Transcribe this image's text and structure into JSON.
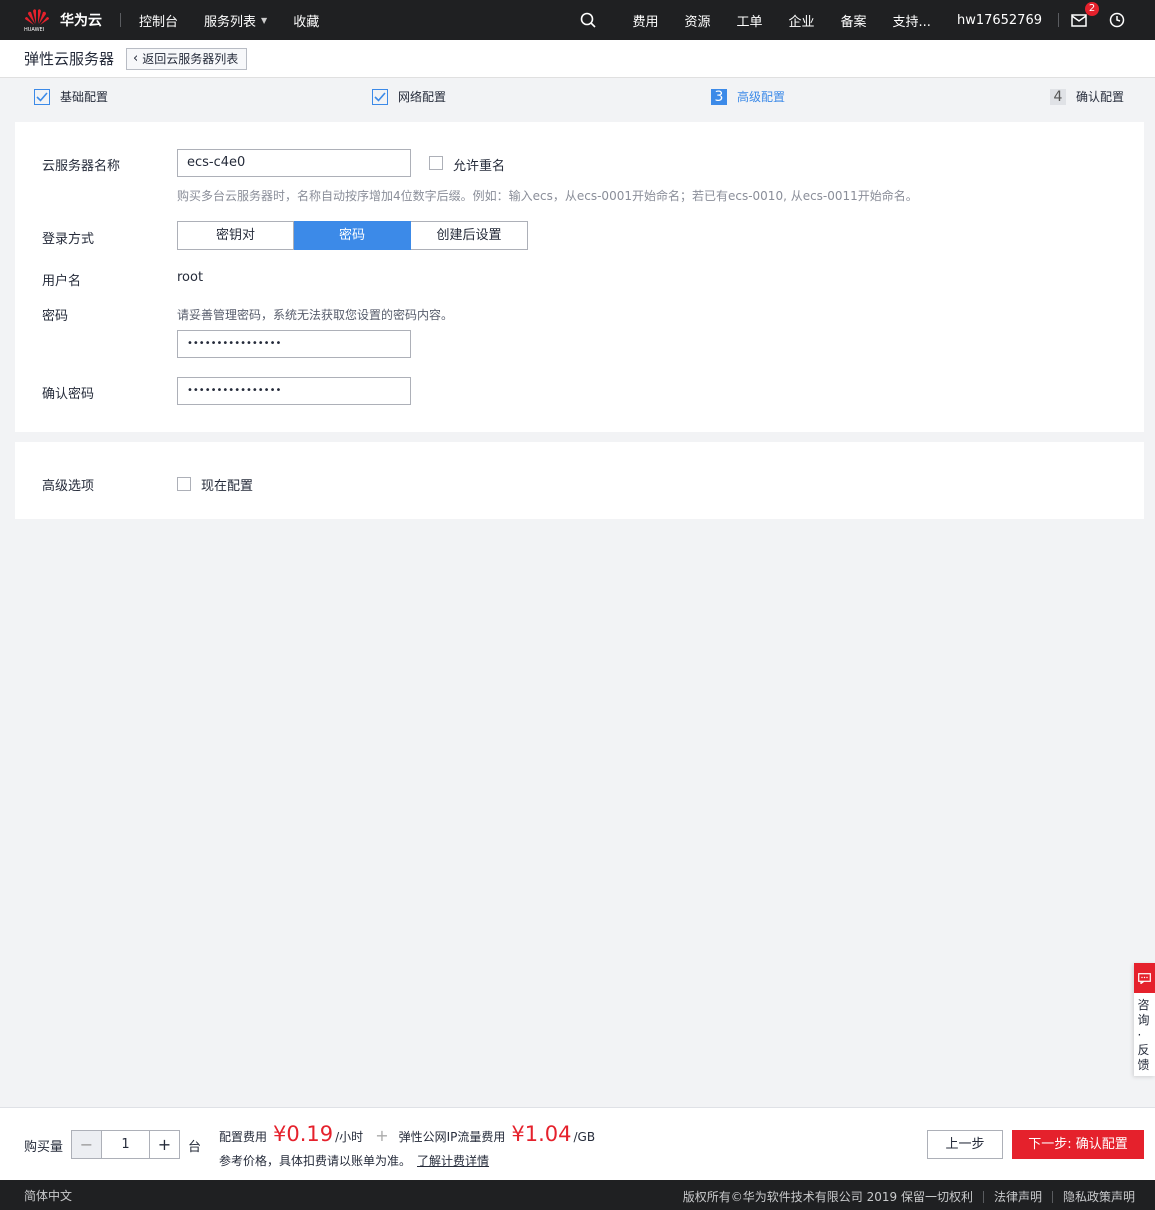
{
  "topbar": {
    "logo_text": "华为云",
    "logo_brand": "HUAWEI",
    "nav": [
      "控制台",
      "服务列表",
      "收藏"
    ],
    "right_items": [
      "费用",
      "资源",
      "工单",
      "企业",
      "备案",
      "支持..."
    ],
    "username": "hw17652769",
    "mail_badge": "2"
  },
  "subheader": {
    "title": "弹性云服务器",
    "back_label": "返回云服务器列表"
  },
  "steps": [
    {
      "label": "基础配置",
      "state": "done"
    },
    {
      "label": "网络配置",
      "state": "done"
    },
    {
      "label": "高级配置",
      "state": "active",
      "number": "3"
    },
    {
      "label": "确认配置",
      "state": "todo",
      "number": "4"
    }
  ],
  "form": {
    "name_label": "云服务器名称",
    "name_value": "ecs-c4e0",
    "allow_dup_label": "允许重名",
    "name_hint": "购买多台云服务器时，名称自动按序增加4位数字后缀。例如：输入ecs，从ecs-0001开始命名；若已有ecs-0010, 从ecs-0011开始命名。",
    "login_label": "登录方式",
    "login_options": [
      "密钥对",
      "密码",
      "创建后设置"
    ],
    "login_selected": "密码",
    "username_label": "用户名",
    "username_value": "root",
    "password_label": "密码",
    "password_hint": "请妥善管理密码，系统无法获取您设置的密码内容。",
    "password_value": "••••••••••••••••",
    "confirm_label": "确认密码",
    "confirm_value": "••••••••••••••••"
  },
  "advanced": {
    "label": "高级选项",
    "option_label": "现在配置"
  },
  "purchase": {
    "qty_label": "购买量",
    "qty_value": "1",
    "minus": "−",
    "plus": "+",
    "unit": "台",
    "config_fee_label": "配置费用",
    "config_fee_value": "¥0.19",
    "config_fee_unit": "/小时",
    "plus_sign": "+",
    "ip_fee_label": "弹性公网IP流量费用",
    "ip_fee_value": "¥1.04",
    "ip_fee_unit": "/GB",
    "ref_text": "参考价格，具体扣费请以账单为准。",
    "ref_link": "了解计费详情",
    "prev_label": "上一步",
    "next_label": "下一步: 确认配置"
  },
  "footer": {
    "lang": "简体中文",
    "copyright": "版权所有©华为软件技术有限公司 2019 保留一切权利",
    "legal": "法律声明",
    "privacy": "隐私政策声明"
  },
  "feedback": {
    "text": "咨询·反馈"
  },
  "colors": {
    "brand_red": "#e5212c",
    "accent_blue": "#3c8ae8",
    "topbar_bg": "#1f2022"
  }
}
